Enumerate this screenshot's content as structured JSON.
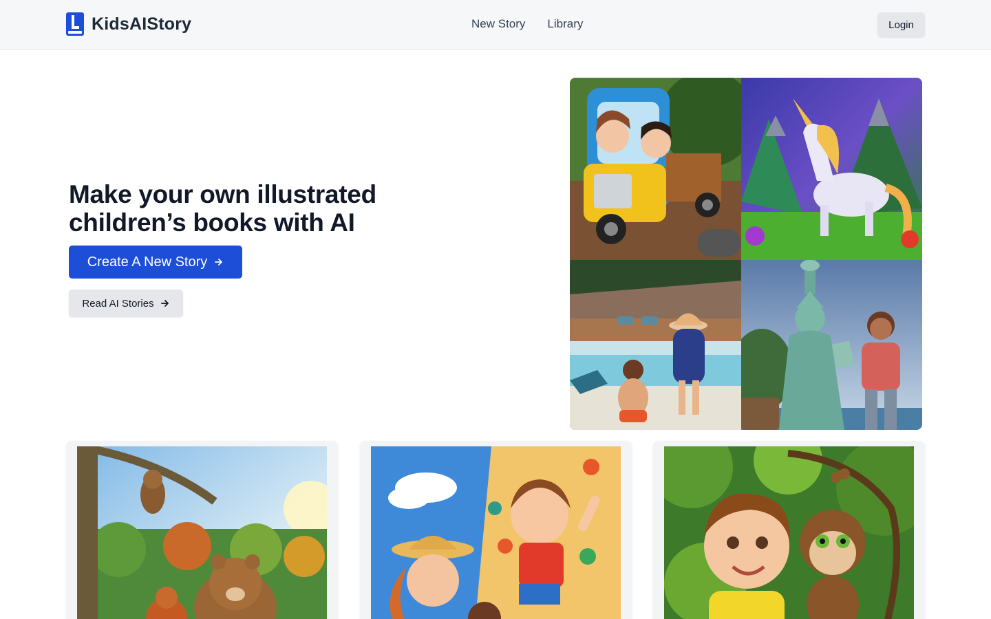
{
  "header": {
    "brand": "KidsAIStory",
    "nav": [
      {
        "label": "New Story"
      },
      {
        "label": "Library"
      }
    ],
    "login_label": "Login"
  },
  "hero": {
    "headline_line1": "Make your own illustrated",
    "headline_line2": "children’s books with AI",
    "primary_cta": "Create A New Story",
    "secondary_cta": "Read AI Stories"
  },
  "collage": [
    {
      "subject": "kids-in-toy-truck"
    },
    {
      "subject": "unicorn-in-mountains"
    },
    {
      "subject": "kids-at-pool"
    },
    {
      "subject": "statue-of-liberty-with-boy"
    }
  ],
  "cards": [
    {
      "subject": "owl-bear-squirrel-forest"
    },
    {
      "subject": "boy-climbing-wall"
    },
    {
      "subject": "boy-and-monkey-jungle"
    }
  ],
  "colors": {
    "primary": "#1d4ed8",
    "header_bg": "#f6f7f9",
    "button_gray": "#e5e7eb",
    "text_dark": "#111827"
  }
}
